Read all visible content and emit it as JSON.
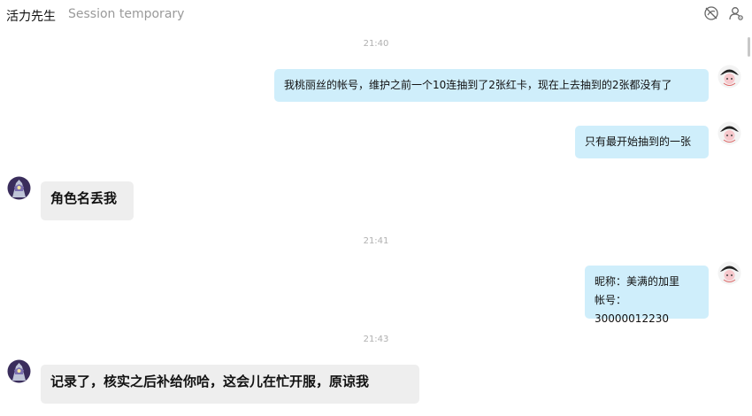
{
  "header": {
    "contact_name": "活力先生",
    "session_label": "Session temporary",
    "icons": [
      "no-disturb-icon",
      "user-settings-icon"
    ]
  },
  "messages": [
    {
      "type": "timestamp",
      "text": "21:40"
    },
    {
      "type": "out",
      "text": "我桃丽丝的帐号，维护之前一个10连抽到了2张红卡，现在上去抽到的2张都没有了"
    },
    {
      "type": "out",
      "text": "只有最开始抽到的一张"
    },
    {
      "type": "in",
      "text": "角色名丢我"
    },
    {
      "type": "timestamp",
      "text": "21:41"
    },
    {
      "type": "out",
      "lines": [
        "昵称：美满的加里",
        "帐号：30000012230"
      ]
    },
    {
      "type": "timestamp",
      "text": "21:43"
    },
    {
      "type": "in",
      "text": "记录了，核实之后补给你哈，这会儿在忙开服，原谅我"
    }
  ],
  "colors": {
    "outgoing_bubble": "#cfeefb",
    "incoming_bubble": "#eeeeee",
    "timestamp_text": "#b0b0b0",
    "session_text": "#9a9a9a"
  }
}
